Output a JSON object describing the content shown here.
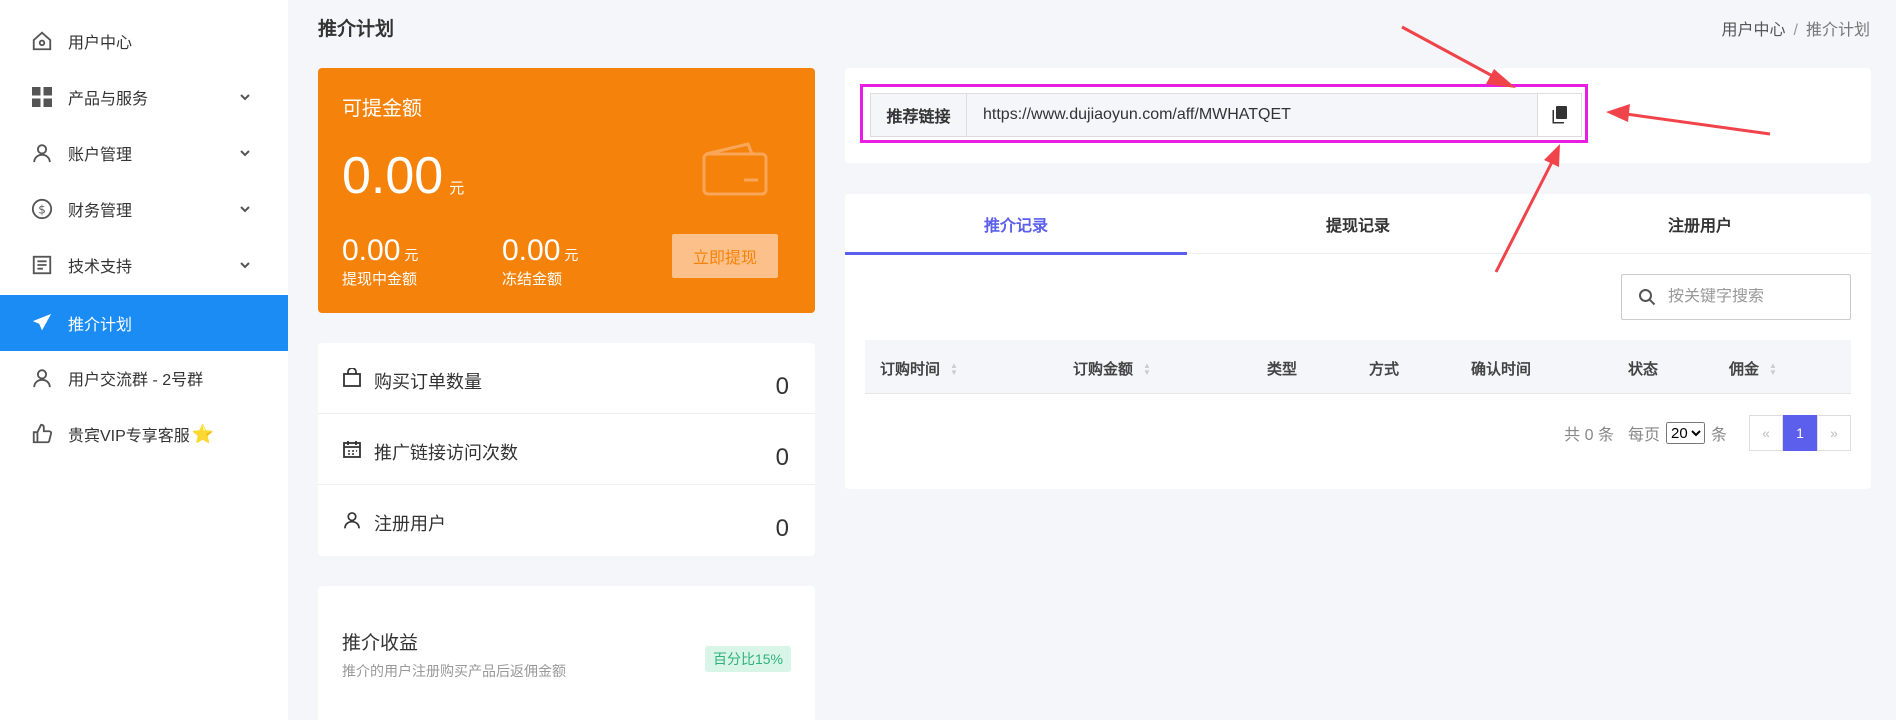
{
  "sidebar": {
    "items": [
      {
        "label": "用户中心",
        "icon": "home-icon"
      },
      {
        "label": "产品与服务",
        "icon": "grid-icon"
      },
      {
        "label": "账户管理",
        "icon": "user-icon"
      },
      {
        "label": "财务管理",
        "icon": "dollar-circle-icon"
      },
      {
        "label": "技术支持",
        "icon": "document-icon"
      },
      {
        "label": "推介计划",
        "icon": "paper-plane-icon"
      },
      {
        "label": "用户交流群 - 2号群",
        "icon": "user-icon"
      },
      {
        "label": "贵宾VIP专享客服",
        "icon": "thumbs-up-icon",
        "suffix": "⭐"
      }
    ],
    "active_color": "#1b8cf4"
  },
  "header": {
    "title": "推介计划",
    "breadcrumb": [
      "用户中心",
      "/",
      "推介计划"
    ]
  },
  "balance": {
    "title": "可提金额",
    "amount": "0.00",
    "unit": "元",
    "withdrawing_value": "0.00",
    "withdrawing_unit": "元",
    "withdrawing_label": "提现中金额",
    "frozen_value": "0.00",
    "frozen_unit": "元",
    "frozen_label": "冻结金额",
    "withdraw_button": "立即提现",
    "color": "#f5820a"
  },
  "stats": [
    {
      "label": "购买订单数量",
      "value": "0",
      "icon": "shopping-bag-icon"
    },
    {
      "label": "推广链接访问次数",
      "value": "0",
      "icon": "calendar-icon"
    },
    {
      "label": "注册用户",
      "value": "0",
      "icon": "user-icon"
    }
  ],
  "earnings": {
    "title": "推介收益",
    "description": "推介的用户注册购买产品后返佣金额",
    "badge": "百分比15%"
  },
  "referral": {
    "label": "推荐链接",
    "url": "https://www.dujiaoyun.com/aff/MWHATQET",
    "copy_icon": "copy-icon",
    "highlight_color": "#e81ee0"
  },
  "records": {
    "tabs": [
      "推介记录",
      "提现记录",
      "注册用户"
    ],
    "search_placeholder": "按关键字搜索",
    "columns": [
      "订购时间",
      "订购金额",
      "类型",
      "方式",
      "确认时间",
      "状态",
      "佣金"
    ],
    "pager": {
      "total": "共 0 条",
      "per_page_label": "每页",
      "per_page": "20",
      "per_page_suffix": "条",
      "prev": "«",
      "current": "1",
      "next": "»"
    },
    "accent": "#5b5fec"
  }
}
